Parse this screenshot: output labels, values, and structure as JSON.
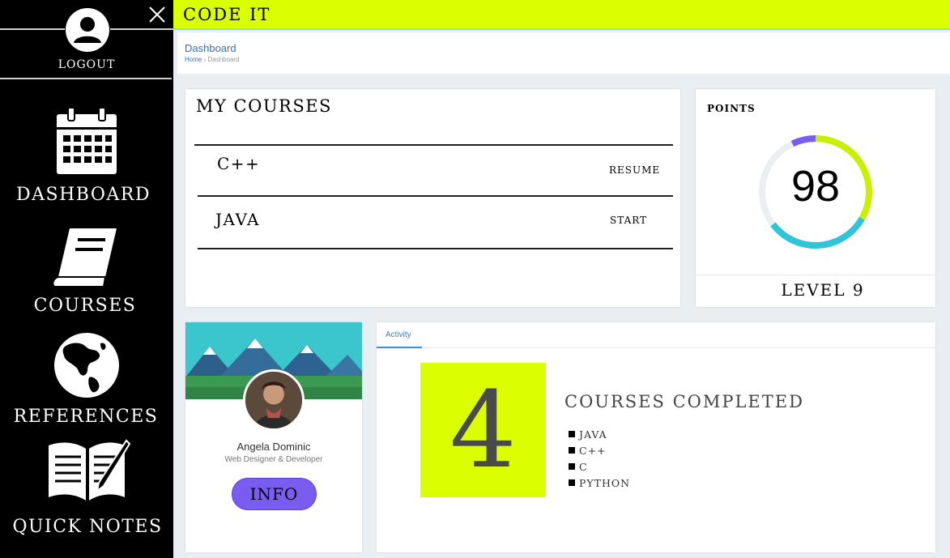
{
  "app": {
    "title": "CODE IT"
  },
  "sidebar": {
    "logout_label": "LOGOUT",
    "items": [
      {
        "label": "DASHBOARD",
        "icon": "calendar-icon"
      },
      {
        "label": "COURSES",
        "icon": "book-icon"
      },
      {
        "label": "REFERENCES",
        "icon": "globe-icon"
      },
      {
        "label": "QUICK NOTES",
        "icon": "notebook-pen-icon"
      }
    ]
  },
  "breadcrumb": {
    "title": "Dashboard",
    "home": "Home",
    "separator": "›",
    "current": "Dashboard"
  },
  "my_courses": {
    "title": "MY COURSES",
    "items": [
      {
        "name": "C++",
        "action": "RESUME"
      },
      {
        "name": "JAVA",
        "action": "START"
      }
    ]
  },
  "points": {
    "label": "POINTS",
    "value": "98",
    "level": "LEVEL 9"
  },
  "profile": {
    "name": "Angela Dominic",
    "role": "Web Designer & Developer",
    "button": "INFO"
  },
  "activity": {
    "tab": "Activity",
    "count": "4",
    "title": "COURSES COMPLETED",
    "courses": [
      "JAVA",
      "C++",
      "C",
      "PYTHON"
    ]
  },
  "colors": {
    "accent": "#dcff00",
    "info_button": "#7a5cf0",
    "gauge_cyan": "#2ec5d8",
    "gauge_lime": "#c8f000",
    "gauge_purple": "#7a5cf0"
  }
}
